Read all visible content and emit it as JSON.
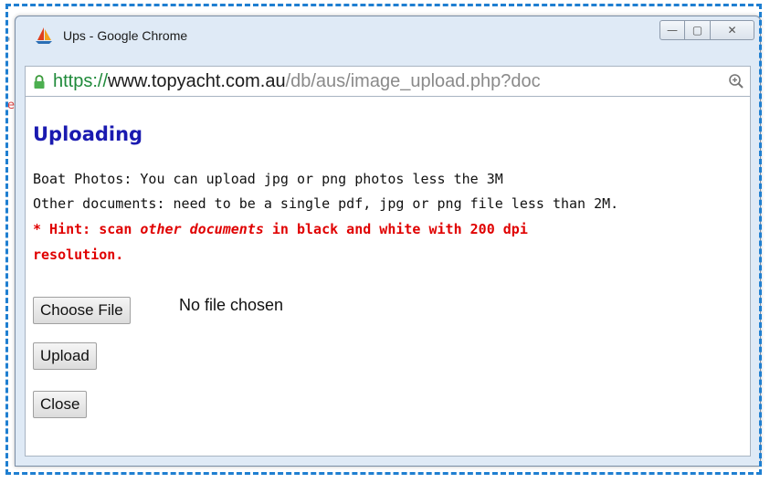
{
  "window": {
    "title": "Ups - Google Chrome",
    "buttons": {
      "minimize": "—",
      "maximize": "▢",
      "close": "✕"
    }
  },
  "address_bar": {
    "scheme": "https://",
    "domain": "www.topyacht.com.au",
    "path": "/db/aus/image_upload.php?doc"
  },
  "page": {
    "heading": "Uploading",
    "lines": [
      "Boat Photos: You can upload jpg or png photos less the 3M",
      "Other documents: need to be a single pdf, jpg or png file less than 2M."
    ],
    "hint": {
      "prefix": "* Hint: scan ",
      "emphasis": "other documents",
      "suffix": " in black and white with 200 dpi",
      "line2": "resolution."
    },
    "file_input": {
      "button_label": "Choose File",
      "status": "No file chosen"
    },
    "upload_label": "Upload",
    "close_label": "Close"
  },
  "colors": {
    "heading": "#1a1ab0",
    "hint": "#e00000",
    "url_scheme": "#1f8a3a",
    "selection_border": "#1f7fd1"
  }
}
